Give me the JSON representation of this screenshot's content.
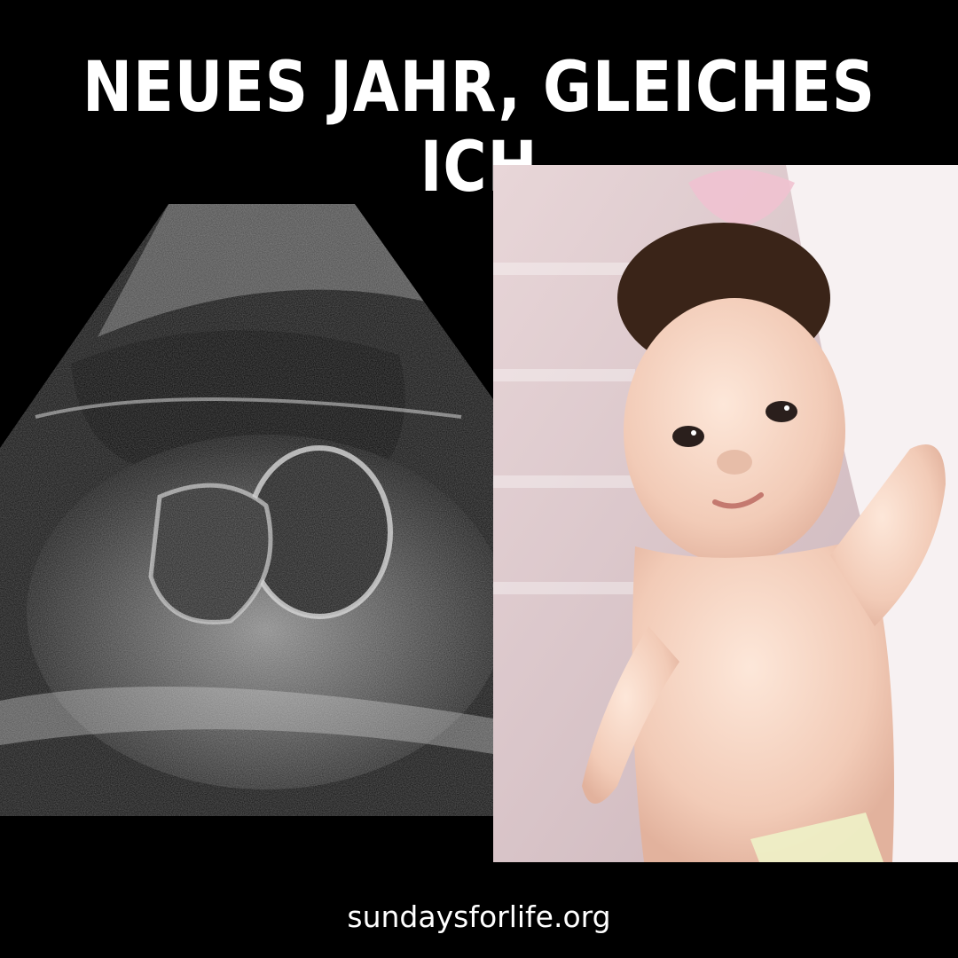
{
  "headline": "NEUES JAHR, GLEICHES ICH",
  "footer": {
    "url": "sundaysforlife.org"
  },
  "images": {
    "left": "ultrasound-image",
    "right": "baby-photo"
  },
  "colors": {
    "background": "#000000",
    "text": "#ffffff"
  }
}
